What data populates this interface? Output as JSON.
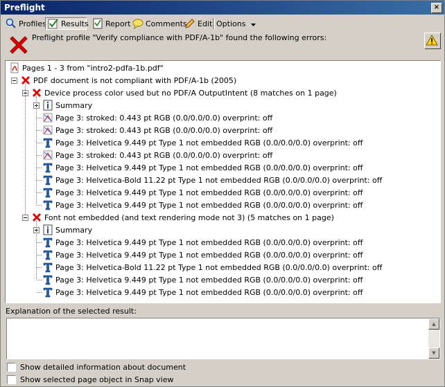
{
  "window": {
    "title": "Preflight",
    "close_glyph": "×"
  },
  "toolbar": {
    "profiles": "Profiles",
    "results": "Results",
    "report": "Report",
    "comments": "Comments",
    "edit": "Edit",
    "options": "Options"
  },
  "message": "Preflight profile \"Verify compliance with PDF/A-1b\" found the following errors:",
  "tree": {
    "root": "Pages 1 - 3 from \"intro2-pdfa-1b.pdf\"",
    "doc": "PDF document is not compliant with PDF/A-1b (2005)",
    "group1": {
      "title": "Device process color used but no PDF/A OutputIntent (8 matches on 1 page)",
      "summary": "Summary",
      "items": [
        "Page 3:  stroked: 0.443 pt RGB (0.0/0.0/0.0)  overprint: off",
        "Page 3:  stroked: 0.443 pt RGB (0.0/0.0/0.0)  overprint: off",
        "Page 3: Helvetica 9.449 pt Type 1 not embedded RGB (0.0/0.0/0.0)  overprint: off",
        "Page 3:  stroked: 0.443 pt RGB (0.0/0.0/0.0)  overprint: off",
        "Page 3: Helvetica 9.449 pt Type 1 not embedded RGB (0.0/0.0/0.0)  overprint: off",
        "Page 3: Helvetica-Bold 11.22 pt Type 1 not embedded RGB (0.0/0.0/0.0)  overprint: off",
        "Page 3: Helvetica 9.449 pt Type 1 not embedded RGB (0.0/0.0/0.0)  overprint: off",
        "Page 3: Helvetica 9.449 pt Type 1 not embedded RGB (0.0/0.0/0.0)  overprint: off"
      ]
    },
    "group2": {
      "title": "Font not embedded (and text rendering mode not 3) (5 matches on 1 page)",
      "summary": "Summary",
      "items": [
        "Page 3: Helvetica 9.449 pt Type 1 not embedded RGB (0.0/0.0/0.0)  overprint: off",
        "Page 3: Helvetica 9.449 pt Type 1 not embedded RGB (0.0/0.0/0.0)  overprint: off",
        "Page 3: Helvetica-Bold 11.22 pt Type 1 not embedded RGB (0.0/0.0/0.0)  overprint: off",
        "Page 3: Helvetica 9.449 pt Type 1 not embedded RGB (0.0/0.0/0.0)  overprint: off",
        "Page 3: Helvetica 9.449 pt Type 1 not embedded RGB (0.0/0.0/0.0)  overprint: off"
      ]
    }
  },
  "explanation_label": "Explanation of the selected result:",
  "checkboxes": {
    "detailed": "Show detailed information about document",
    "snap": "Show selected page object in Snap view"
  },
  "colors": {
    "title_start": "#0a246a",
    "title_end": "#3a6ea5",
    "error_red": "#e00000",
    "face": "#d4d0c8"
  }
}
